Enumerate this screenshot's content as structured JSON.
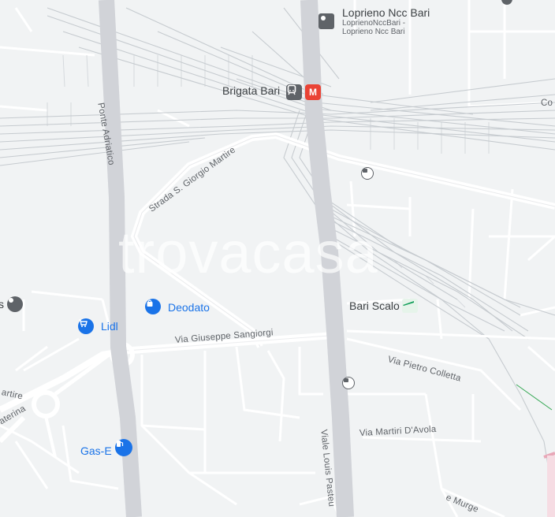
{
  "watermark": "trovacasa",
  "pois": {
    "loprieno": {
      "name": "Loprieno Ncc Bari",
      "sub1": "LoprienoNccBari -",
      "sub2": "Loprieno Ncc Bari"
    },
    "brigata": {
      "name": "Brigata Bari",
      "metro_letter": "M"
    },
    "bari_scalo": {
      "name": "Bari Scalo"
    },
    "deodato": {
      "name": "Deodato"
    },
    "lidl": {
      "name": "Lidl"
    },
    "gas": {
      "name": "Gas-E"
    }
  },
  "streets": {
    "ponte_adriatico": "Ponte Adriatico",
    "strada_giorgio": "Strada S. Giorgio Martire",
    "sangiorgi": "Via Giuseppe Sangiorgi",
    "colletta": "Via Pietro Colletta",
    "martiri": "Via Martiri D'Avola",
    "pasteur": "Viale Louis Pasteu",
    "murge": "e Murge",
    "cor": "Co",
    "martire_left": "artire",
    "caterina": "aterina"
  },
  "colors": {
    "background": "#f1f3f4",
    "road": "#ffffff",
    "major_road": "#dadce0",
    "rail": "#b7bdc3",
    "metro_red": "#ea4335",
    "poi_blue": "#1a73e8",
    "poi_gray": "#5f6368",
    "train_green": "#0f9d58"
  },
  "icons": [
    "place-icon",
    "train-station-icon",
    "metro-icon",
    "bus-stop-icon",
    "shopping-cart-icon",
    "shopping-bag-icon",
    "gas-station-icon",
    "train-icon"
  ]
}
